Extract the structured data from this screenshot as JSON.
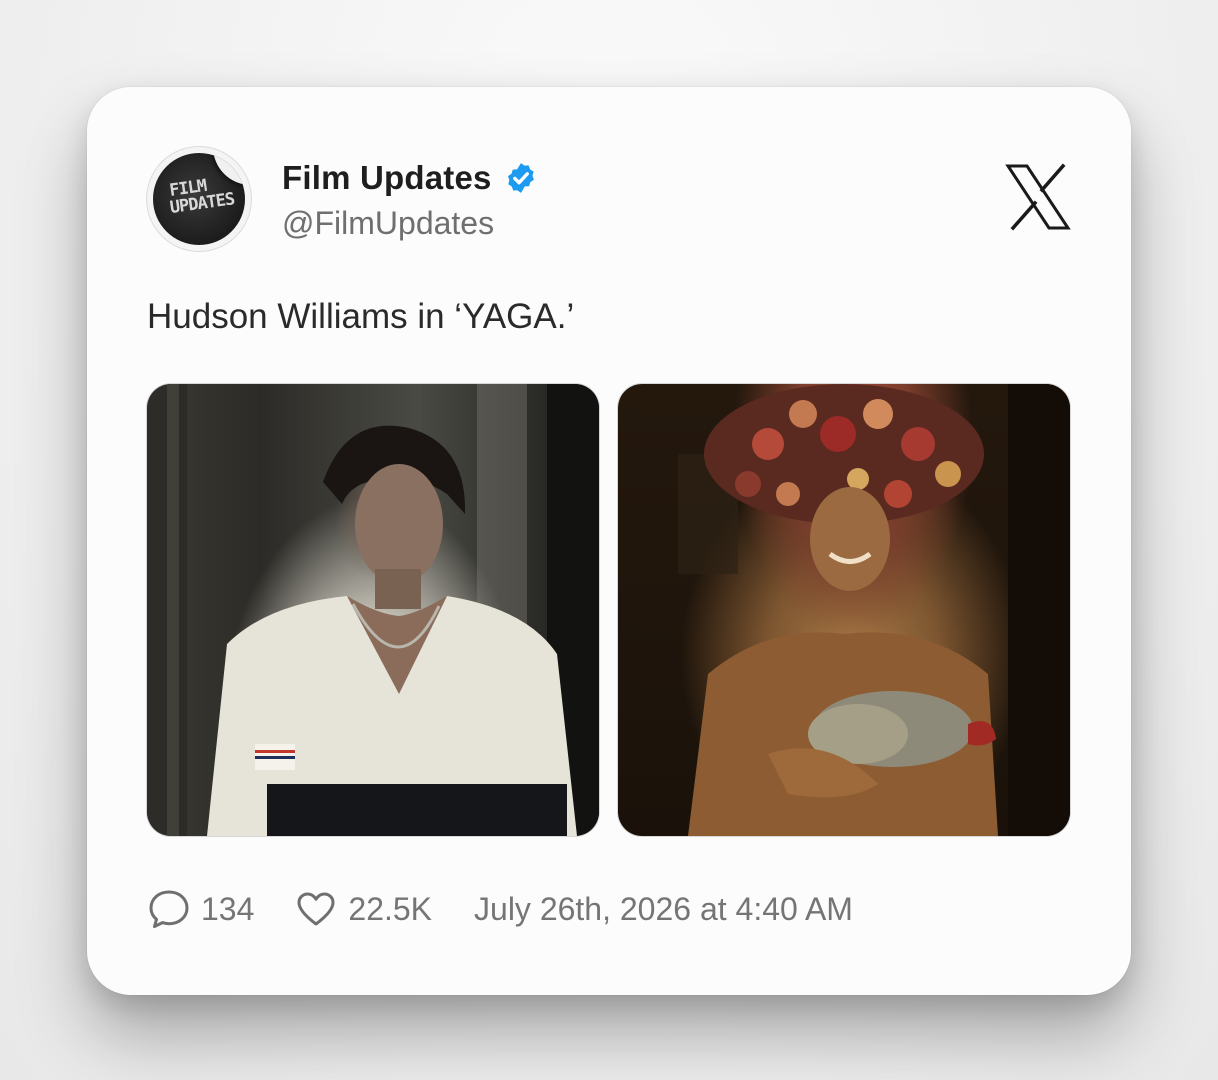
{
  "tweet": {
    "author": {
      "name": "Film Updates",
      "handle": "@FilmUpdates",
      "verified": true,
      "avatar_text": [
        "FILM",
        "UPDATES"
      ]
    },
    "text": "Hudson Williams in ‘YAGA.’",
    "media": [
      {
        "alt": "photo-1"
      },
      {
        "alt": "photo-2"
      }
    ],
    "stats": {
      "replies": "134",
      "likes": "22.5K"
    },
    "timestamp": "July 26th, 2026 at 4:40 AM"
  },
  "icons": {
    "verified": "verified-badge-icon",
    "platform": "x-logo-icon",
    "reply": "speech-bubble-icon",
    "like": "heart-icon"
  },
  "colors": {
    "verified": "#1d9bf0",
    "text": "#2a2a2a",
    "muted": "#757575"
  }
}
